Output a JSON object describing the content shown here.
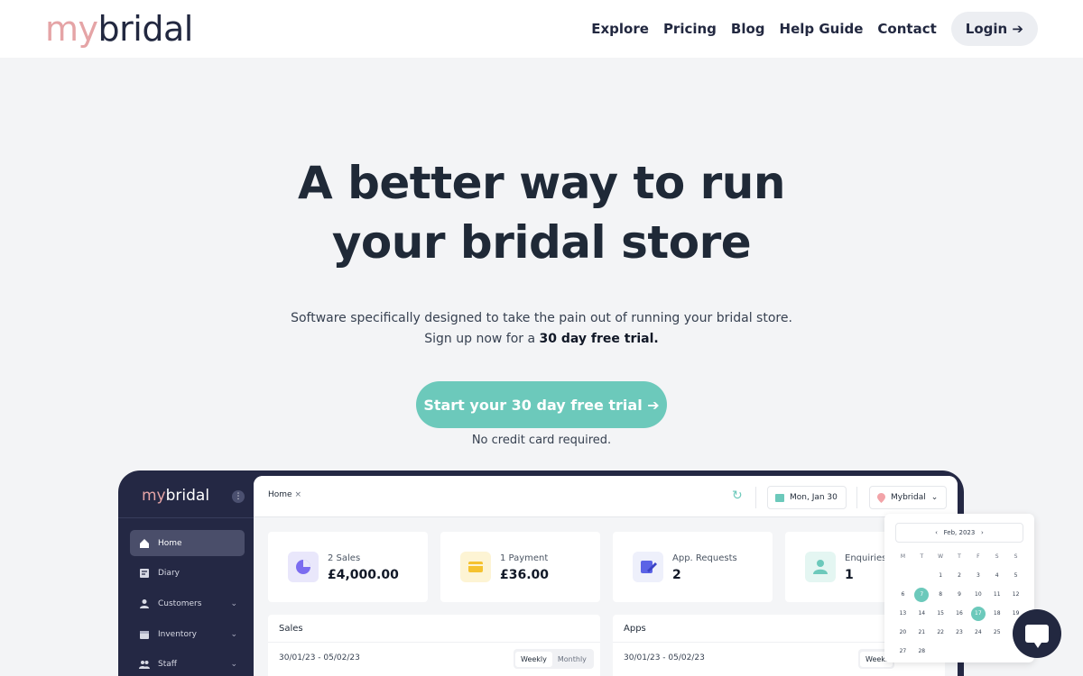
{
  "brand": {
    "my": "my",
    "bridal": "bridal"
  },
  "nav": {
    "items": [
      "Explore",
      "Pricing",
      "Blog",
      "Help Guide",
      "Contact"
    ],
    "login": "Login ➔"
  },
  "hero": {
    "title_line1": "A better way to run",
    "title_line2": "your bridal store",
    "sub_line1": "Software specifically designed to take the pain out of running your bridal store.",
    "sub_line2_prefix": "Sign up now for a ",
    "sub_line2_bold": "30 day free trial.",
    "cta": "Start your 30 day free trial ➔",
    "note": "No credit card required."
  },
  "app": {
    "sidebar": {
      "brand_my": "my",
      "brand_bridal": "bridal",
      "kebab": "⋮",
      "items": [
        {
          "label": "Home",
          "icon": "home-icon",
          "active": true
        },
        {
          "label": "Diary",
          "icon": "diary-icon"
        },
        {
          "label": "Customers",
          "icon": "user-icon",
          "chevron": "⌄"
        },
        {
          "label": "Inventory",
          "icon": "box-icon",
          "chevron": "⌄"
        },
        {
          "label": "Staff",
          "icon": "users-icon",
          "chevron": "⌄"
        }
      ]
    },
    "topbar": {
      "tab": "Home",
      "tab_close": "×",
      "refresh": "↻",
      "date": "Mon, Jan 30",
      "store": "Mybridal",
      "store_chevron": "⌄"
    },
    "cards": [
      {
        "label": "2 Sales",
        "value": "£4,000.00",
        "icon": "pie-chart-icon",
        "color": "#e9e7fb"
      },
      {
        "label": "1 Payment",
        "value": "£36.00",
        "icon": "wallet-icon",
        "color": "#fdf4d4"
      },
      {
        "label": "App. Requests",
        "value": "2",
        "icon": "edit-icon",
        "color": "#eef0fb"
      },
      {
        "label": "Enquiries",
        "value": "1",
        "icon": "person-icon",
        "color": "#e4f6f2"
      }
    ],
    "panels": [
      {
        "title": "Sales",
        "range": "30/01/23 - 05/02/23",
        "seg": [
          "Weekly",
          "Monthly"
        ]
      },
      {
        "title": "Apps",
        "range": "30/01/23 - 05/02/23",
        "seg": [
          "Weekl"
        ]
      }
    ],
    "calendar": {
      "month": "Feb, 2023",
      "prev": "‹",
      "next": "›",
      "dow": [
        "M",
        "T",
        "W",
        "T",
        "F",
        "S",
        "S"
      ],
      "days": [
        "",
        "",
        "1",
        "2",
        "3",
        "4",
        "5",
        "6",
        "7",
        "8",
        "9",
        "10",
        "11",
        "12",
        "13",
        "14",
        "15",
        "16",
        "17",
        "18",
        "19",
        "20",
        "21",
        "22",
        "23",
        "24",
        "25",
        "26",
        "27",
        "28"
      ],
      "selected": [
        "7",
        "17"
      ]
    }
  },
  "colors": {
    "accent": "#6cc9bb",
    "brand_pink": "#e5a4a6",
    "navy": "#222840"
  }
}
